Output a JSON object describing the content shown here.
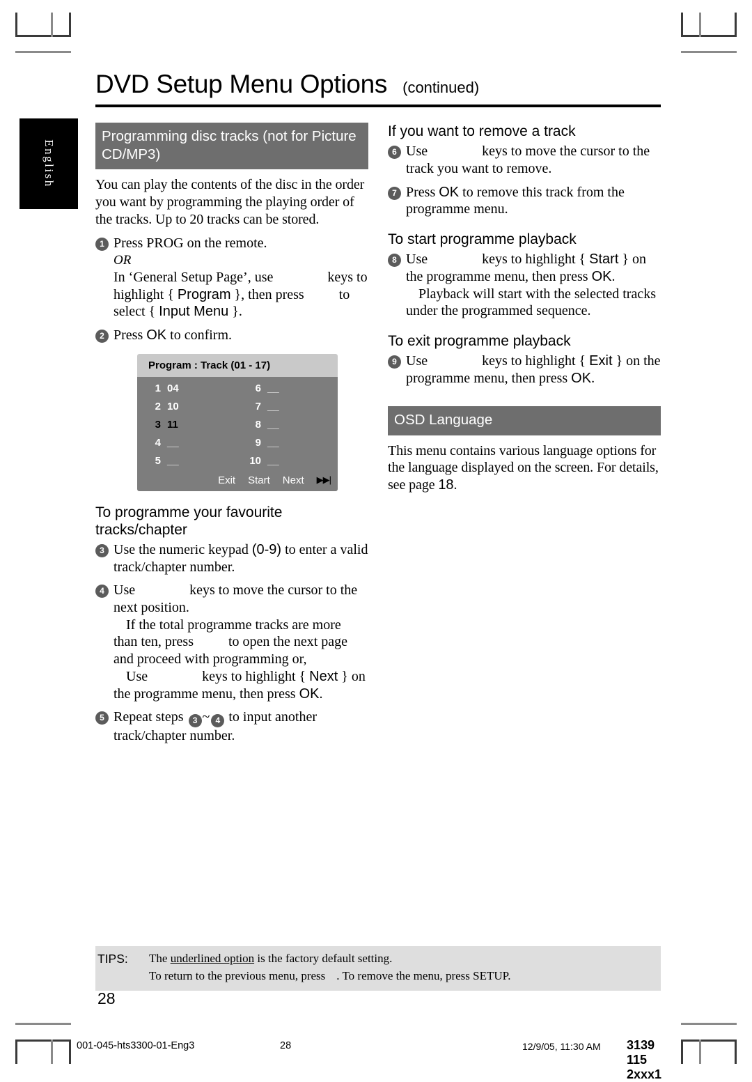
{
  "language_tab": {
    "label": "English"
  },
  "header": {
    "title": "DVD Setup Menu Options",
    "continued": "(continued)"
  },
  "left_column": {
    "section_header": "Programming disc tracks (not for Picture CD/MP3)",
    "intro": "You can play the contents of the disc in the order you want by programming the playing order of the tracks. Up to 20 tracks can be stored.",
    "step1": {
      "number": "1",
      "line1": "Press PROG on the remote.",
      "or": "OR",
      "line2_a": "In ‘General Setup Page’, use",
      "line2_b": "keys to highlight {",
      "line2_menu": "Program",
      "line2_c": "}, then press",
      "line2_d": "to select {",
      "line2_menu2": "Input Menu",
      "line2_e": "}."
    },
    "step2": {
      "number": "2",
      "text_a": "Press",
      "button": "OK",
      "text_b": "to confirm."
    },
    "program_box": {
      "title": "Program : Track (01 - 17)",
      "left_entries": [
        {
          "index": "1",
          "value": "04",
          "selected": false
        },
        {
          "index": "2",
          "value": "10",
          "selected": false
        },
        {
          "index": "3",
          "value": "11",
          "selected": true
        },
        {
          "index": "4",
          "value": "__",
          "selected": false
        },
        {
          "index": "5",
          "value": "__",
          "selected": false
        }
      ],
      "right_entries": [
        {
          "index": "6",
          "value": "__",
          "selected": false
        },
        {
          "index": "7",
          "value": "__",
          "selected": false
        },
        {
          "index": "8",
          "value": "__",
          "selected": false
        },
        {
          "index": "9",
          "value": "__",
          "selected": false
        },
        {
          "index": "10",
          "value": "__",
          "selected": false
        }
      ],
      "actions": [
        "Exit",
        "Start",
        "Next"
      ],
      "next_icon": "▶▶|"
    },
    "subhead_programme": "To programme your favourite tracks/chapter",
    "step3": {
      "number": "3",
      "text_a": "Use the numeric keypad",
      "keypad": "(0-9)",
      "text_b": "to enter a valid track/chapter number."
    },
    "step4": {
      "number": "4",
      "text_a": "Use",
      "text_b": "keys to move the cursor to the next position.",
      "text_c": "If the total programme tracks are more than ten, press",
      "text_d": "to open the next page and proceed with programming or,",
      "text_e": "Use",
      "text_f": "keys to highlight {",
      "menu": "Next",
      "text_g": "} on the programme menu, then press",
      "button": "OK",
      "text_h": "."
    },
    "step5": {
      "number": "5",
      "text_a": "Repeat steps",
      "ref_from": "3",
      "ref_sep": "~",
      "ref_to": "4",
      "text_b": "to input another track/chapter number."
    }
  },
  "right_column": {
    "subhead_remove": "If you want to remove a track",
    "step6": {
      "number": "6",
      "text_a": "Use",
      "text_b": "keys to move the cursor to the track you want to remove."
    },
    "step7": {
      "number": "7",
      "text_a": "Press",
      "button": "OK",
      "text_b": "to remove this track from the programme menu."
    },
    "subhead_start": "To start programme playback",
    "step8": {
      "number": "8",
      "text_a": "Use",
      "text_b": "keys to highlight {",
      "menu": "Start",
      "text_c": "} on the programme menu, then press",
      "button": "OK",
      "text_d": ".",
      "text_e": "Playback will start with the selected tracks under the programmed sequence."
    },
    "subhead_exit": "To exit programme playback",
    "step9": {
      "number": "9",
      "text_a": "Use",
      "text_b": "keys to highlight {",
      "menu": "Exit",
      "text_c": "} on the programme menu, then press",
      "button": "OK",
      "text_d": "."
    },
    "osd_section_header": "OSD Language",
    "osd_body_a": "This menu contains various language options for the language displayed on the screen.  For details, see page",
    "osd_page_ref": "18",
    "osd_body_b": "."
  },
  "tips": {
    "label": "TIPS:",
    "line1_a": "The ",
    "line1_underlined": "underlined option",
    "line1_b": " is the factory default setting.",
    "line2_a": "To return to the previous menu, press",
    "line2_b": ". To remove the menu, press SETUP."
  },
  "page_number": "28",
  "print_footer": {
    "file": "001-045-hts3300-01-Eng3",
    "page": "28",
    "date": "12/9/05, 11:30 AM",
    "code": "3139 115 2xxx1"
  }
}
